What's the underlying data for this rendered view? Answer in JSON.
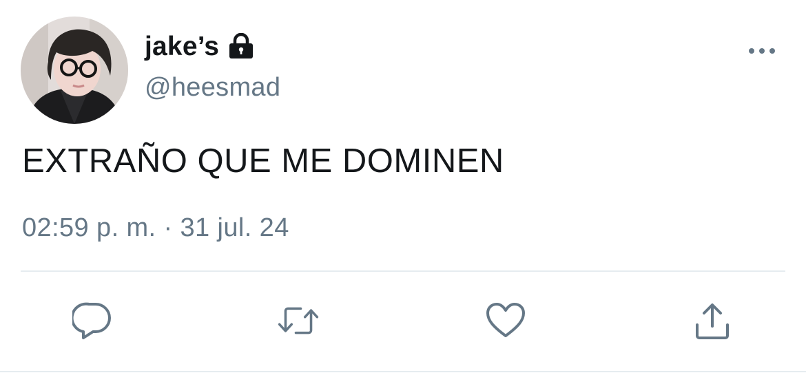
{
  "tweet": {
    "display_name": "jake’s",
    "handle": "@heesmad",
    "text": "EXTRAÑO QUE ME DOMINEN",
    "time": "02:59 p. m.",
    "separator": "·",
    "date": "31 jul. 24",
    "protected": true
  },
  "icons": {
    "lock": "lock-icon",
    "more": "more-horizontal-icon",
    "reply": "reply-icon",
    "retweet": "retweet-icon",
    "like": "heart-icon",
    "share": "share-icon"
  },
  "colors": {
    "text_primary": "#14171a",
    "text_secondary": "#657786",
    "icon": "#657786",
    "divider": "#e6ecf0"
  }
}
